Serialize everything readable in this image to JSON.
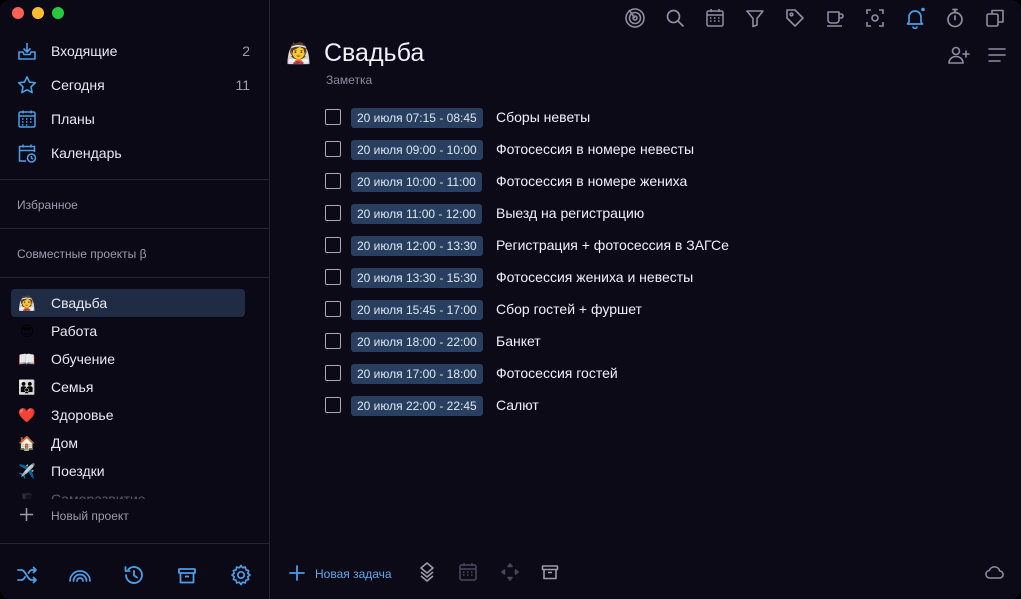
{
  "sidebar": {
    "nav": [
      {
        "label": "Входящие",
        "count": "2",
        "icon": "inbox-icon"
      },
      {
        "label": "Сегодня",
        "count": "11",
        "icon": "star-icon"
      },
      {
        "label": "Планы",
        "count": "",
        "icon": "plans-calendar-icon"
      },
      {
        "label": "Календарь",
        "count": "",
        "icon": "calendar-clock-icon"
      }
    ],
    "favorites_label": "Избранное",
    "shared_label": "Совместные проекты β",
    "projects": [
      {
        "emoji": "👰",
        "label": "Свадьба",
        "active": true
      },
      {
        "emoji": "😎",
        "label": "Работа"
      },
      {
        "emoji": "📖",
        "label": "Обучение"
      },
      {
        "emoji": "👪",
        "label": "Семья"
      },
      {
        "emoji": "❤️",
        "label": "Здоровье"
      },
      {
        "emoji": "🏠",
        "label": "Дом"
      },
      {
        "emoji": "✈️",
        "label": "Поездки"
      },
      {
        "emoji": "🎩",
        "label": "Саморазвитие"
      }
    ],
    "new_project_label": "Новый проект",
    "bottom_icons": [
      "shuffle-icon",
      "rainbow-icon",
      "history-icon",
      "trash-icon",
      "settings-icon"
    ]
  },
  "toolbar": {
    "icons": [
      "focus-icon",
      "search-icon",
      "calendar-icon",
      "filter-icon",
      "tag-icon",
      "coffee-icon",
      "scan-icon",
      "bell-icon",
      "timer-icon",
      "copy-icon"
    ]
  },
  "project": {
    "emoji": "👰",
    "title": "Свадьба",
    "note_label": "Заметка"
  },
  "tasks": [
    {
      "time": "20 июля 07:15 - 08:45",
      "name": "Сборы неветы"
    },
    {
      "time": "20 июля 09:00 - 10:00",
      "name": "Фотосессия в номере невесты"
    },
    {
      "time": "20 июля 10:00 - 11:00",
      "name": "Фотосессия в номере жениха"
    },
    {
      "time": "20 июля 11:00 - 12:00",
      "name": "Выезд на регистрацию"
    },
    {
      "time": "20 июля 12:00 - 13:30",
      "name": "Регистрация + фотосессия в ЗАГСе"
    },
    {
      "time": "20 июля 13:30 - 15:30",
      "name": "Фотосессия жениха и невесты"
    },
    {
      "time": "20 июля 15:45 - 17:00",
      "name": "Сбор гостей + фуршет"
    },
    {
      "time": "20 июля 18:00 - 22:00",
      "name": "Банкет"
    },
    {
      "time": "20 июля 17:00 - 18:00",
      "name": "Фотосессия гостей"
    },
    {
      "time": "20 июля 22:00 - 22:45",
      "name": "Салют"
    }
  ],
  "footer": {
    "new_task_label": "Новая задача"
  },
  "colors": {
    "accent": "#4a9fe8",
    "chip_bg": "#283f5f",
    "active_project_bg": "#1f2c44",
    "background": "#0c0a17"
  }
}
